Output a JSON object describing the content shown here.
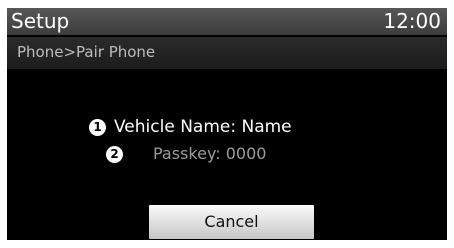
{
  "header": {
    "title": "Setup",
    "time": "12:00"
  },
  "breadcrumb": "Phone>Pair Phone",
  "pairing_info": {
    "vehicle_marker": "1",
    "vehicle_name": "Vehicle Name: Name",
    "passkey_marker": "2",
    "passkey": "Passkey: 0000"
  },
  "actions": {
    "cancel_label": "Cancel"
  }
}
